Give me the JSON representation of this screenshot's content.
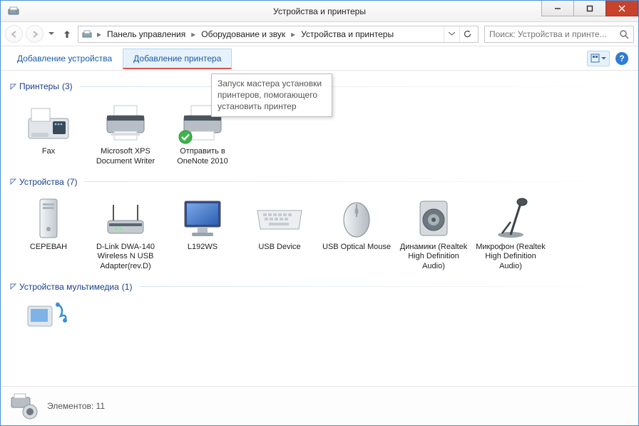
{
  "window": {
    "title": "Устройства и принтеры"
  },
  "nav": {
    "breadcrumbs": [
      "Панель управления",
      "Оборудование и звук",
      "Устройства и принтеры"
    ]
  },
  "search": {
    "placeholder": "Поиск: Устройства и принте..."
  },
  "toolbar": {
    "add_device": "Добавление устройства",
    "add_printer": "Добавление принтера",
    "help_symbol": "?"
  },
  "tooltip": {
    "text": "Запуск мастера установки принтеров, помогающего установить принтер"
  },
  "sections": {
    "printers": {
      "title": "Принтеры",
      "count": "(3)"
    },
    "devices": {
      "title": "Устройства",
      "count": "(7)"
    },
    "media": {
      "title": "Устройства мультимедиа",
      "count": "(1)"
    }
  },
  "printers": [
    {
      "name": "Fax"
    },
    {
      "name": "Microsoft XPS Document Writer"
    },
    {
      "name": "Отправить в OneNote 2010"
    }
  ],
  "devices": [
    {
      "name": "СЕРЕВАН"
    },
    {
      "name": "D-Link DWA-140 Wireless N USB Adapter(rev.D)"
    },
    {
      "name": "L192WS"
    },
    {
      "name": "USB Device"
    },
    {
      "name": "USB Optical Mouse"
    },
    {
      "name": "Динамики (Realtek High Definition Audio)"
    },
    {
      "name": "Микрофон (Realtek High Definition Audio)"
    }
  ],
  "status": {
    "label": "Элементов:",
    "count": "11"
  }
}
